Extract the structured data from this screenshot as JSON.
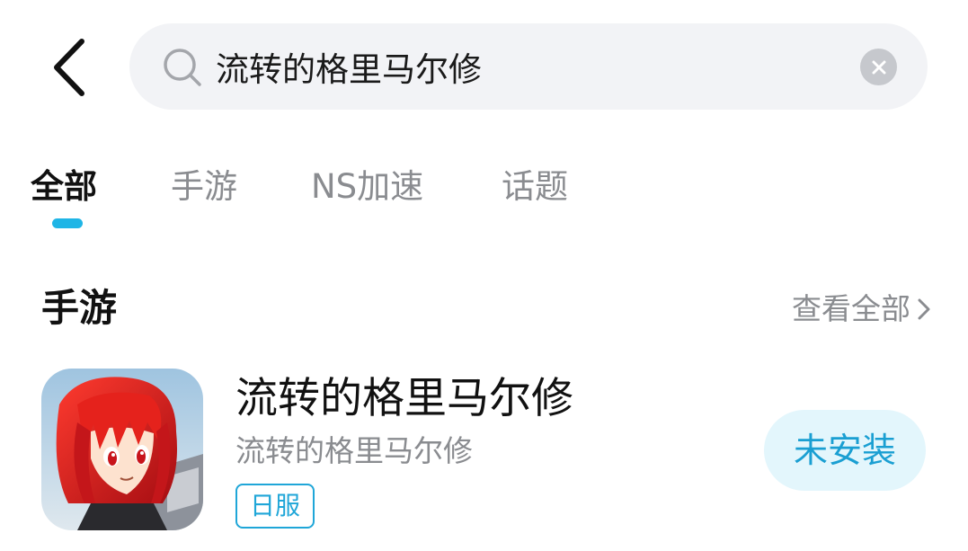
{
  "header": {
    "back_icon": "chevron-left-icon",
    "search": {
      "value": "流转的格里马尔修",
      "icon": "search-icon",
      "clear_icon": "clear-icon"
    }
  },
  "tabs": [
    {
      "label": "全部",
      "active": true
    },
    {
      "label": "手游",
      "active": false
    },
    {
      "label": "NS加速",
      "active": false
    },
    {
      "label": "话题",
      "active": false
    }
  ],
  "accent_color": "#1fb5e6",
  "section": {
    "title": "手游",
    "view_all": "查看全部",
    "view_all_icon": "chevron-right-icon"
  },
  "game": {
    "title": "流转的格里马尔修",
    "subtitle": "流转的格里马尔修",
    "tag": "日服",
    "install_label": "未安装",
    "icon": "game-app-icon"
  }
}
